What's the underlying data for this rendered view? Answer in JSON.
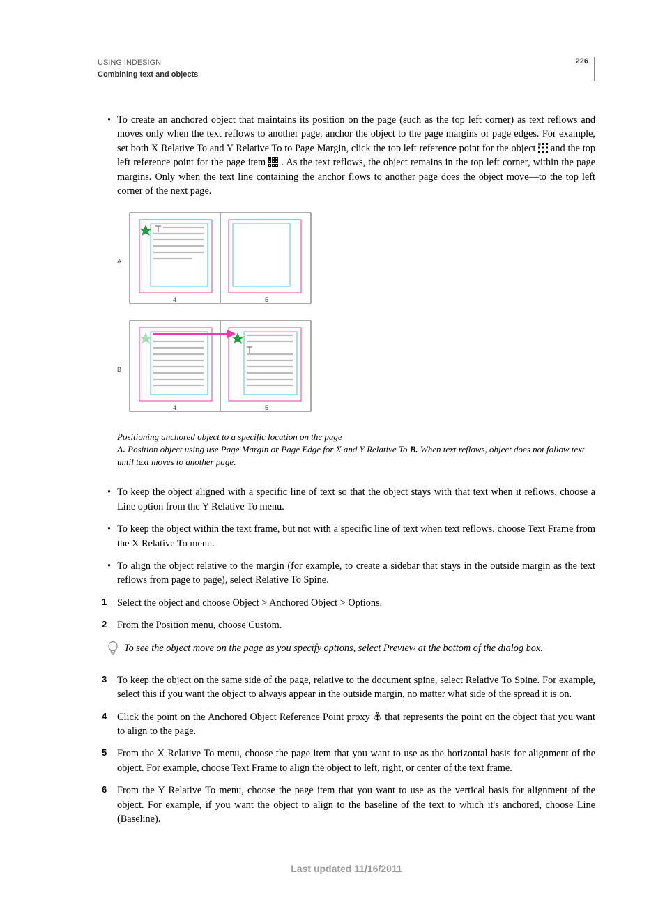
{
  "header": {
    "line1": "USING INDESIGN",
    "line2": "Combining text and objects",
    "page_number": "226"
  },
  "bullets_top": [
    "To create an anchored object that maintains its position on the page (such as the top left corner) as text reflows and moves only when the text reflows to another page, anchor the object to the page margins or page edges. For example, set both X Relative To and Y Relative To to Page Margin, click the top left reference point for the object ",
    " and the top left reference point for the page item ",
    ". As the text reflows, the object remains in the top left corner, within the page margins. Only when the text line containing the anchor flows to another page does the object move—to the top left corner of the next page."
  ],
  "figure": {
    "labels": {
      "A": "A",
      "B": "B",
      "p4": "4",
      "p5": "5"
    },
    "caption_title": "Positioning anchored object to a specific location on the page",
    "caption_A_label": "A.",
    "caption_A": " Position object using use Page Margin or Page Edge for X and Y Relative To  ",
    "caption_B_label": "B.",
    "caption_B": " When text reflows, object does not follow text until text moves to another page."
  },
  "bullets_mid": [
    "To keep the object aligned with a specific line of text so that the object stays with that text when it reflows, choose a Line option from the Y Relative To menu.",
    "To keep the object within the text frame, but not with a specific line of text when text reflows, choose Text Frame from the X Relative To menu.",
    "To align the object relative to the margin (for example, to create a sidebar that stays in the outside margin as the text reflows from page to page), select Relative To Spine."
  ],
  "steps": {
    "s1": "Select the object and choose Object > Anchored Object > Options.",
    "s2": "From the Position menu, choose Custom.",
    "tip": "To see the object move on the page as you specify options, select Preview at the bottom of the dialog box.",
    "s3": "To keep the object on the same side of the page, relative to the document spine, select Relative To Spine. For example, select this if you want the object to always appear in the outside margin, no matter what side of the spread it is on.",
    "s4a": "Click the point on the Anchored Object Reference Point proxy ",
    "s4b": " that represents the point on the object that you want to align to the page.",
    "s5": "From the X Relative To menu, choose the page item that you want to use as the horizontal basis for alignment of the object. For example, choose Text Frame to align the object to left, right, or center of the text frame.",
    "s6": "From the Y Relative To menu, choose the page item that you want to use as the vertical basis for alignment of the object. For example, if you want the object to align to the baseline of the text to which it's anchored, choose Line (Baseline)."
  },
  "footer": "Last updated 11/16/2011"
}
